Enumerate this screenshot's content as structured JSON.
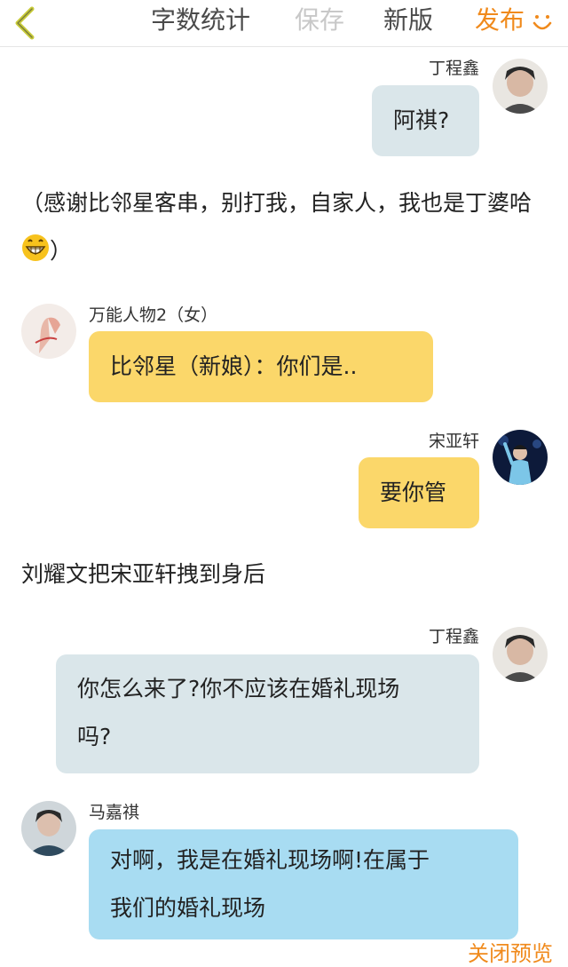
{
  "topbar": {
    "back_icon": "chevron-left-icon",
    "word_count": "字数统计",
    "save": "保存",
    "new_version": "新版",
    "publish": "发布",
    "publish_icon": "smile-icon",
    "colors": {
      "accent": "#f08a1c",
      "disabled": "#c8c8c8",
      "back_icon": "#c9cc3a"
    }
  },
  "messages": [
    {
      "side": "right",
      "name": "丁程鑫",
      "text": "阿祺?",
      "bubble_color": "#dae6ea"
    },
    {
      "narration": "（感谢比邻星客串，别打我，自家人，我也是丁婆哈",
      "emoji": "grinning-face-icon",
      "tail": "）"
    },
    {
      "side": "left",
      "name": "万能人物2（女）",
      "text": "比邻星（新娘）：你们是..",
      "bubble_color": "#fbd76a"
    },
    {
      "side": "right",
      "name": "宋亚轩",
      "text": "要你管",
      "bubble_color": "#fbd76a"
    },
    {
      "narration": "刘耀文把宋亚轩拽到身后"
    },
    {
      "side": "right",
      "name": "丁程鑫",
      "line1": "你怎么来了?你不应该在婚礼现场",
      "line2": "吗?",
      "bubble_color": "#dae6ea"
    },
    {
      "side": "left",
      "name": "马嘉祺",
      "line1": "对啊，我是在婚礼现场啊!在属于",
      "line2": "我们的婚礼现场",
      "bubble_color": "#a8dcf2"
    }
  ],
  "footer": {
    "close_preview": "关闭预览"
  }
}
